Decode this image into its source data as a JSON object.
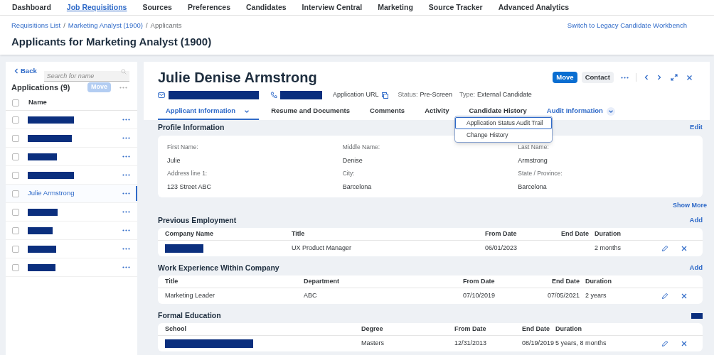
{
  "top_nav": [
    {
      "label": "Dashboard",
      "selected": false
    },
    {
      "label": "Job Requisitions",
      "selected": true
    },
    {
      "label": "Sources",
      "selected": false
    },
    {
      "label": "Preferences",
      "selected": false
    },
    {
      "label": "Candidates",
      "selected": false
    },
    {
      "label": "Interview Central",
      "selected": false
    },
    {
      "label": "Marketing",
      "selected": false
    },
    {
      "label": "Source Tracker",
      "selected": false
    },
    {
      "label": "Advanced Analytics",
      "selected": false
    }
  ],
  "breadcrumbs": [
    "Requisitions List",
    "Marketing Analyst (1900)",
    "Applicants"
  ],
  "breadcrumb_separator": "/",
  "legacy_link": "Switch to Legacy Candidate Workbench",
  "page_title": "Applicants for Marketing Analyst (1900)",
  "sidebar": {
    "back": "Back",
    "search": {
      "placeholder": "Search for name"
    },
    "title": "Applications (9)",
    "all_checked": false,
    "move_button": {
      "label": "Move",
      "disabled": true
    },
    "column": "Name",
    "items": [
      {
        "kind": "redacted",
        "selected": false,
        "checked": false
      },
      {
        "kind": "redacted",
        "selected": false,
        "checked": false
      },
      {
        "kind": "redacted",
        "selected": false,
        "checked": false
      },
      {
        "kind": "redacted",
        "selected": false,
        "checked": false
      },
      {
        "kind": "name",
        "name": "Julie Armstrong",
        "selected": true,
        "checked": false
      },
      {
        "kind": "redacted",
        "selected": false,
        "checked": false
      },
      {
        "kind": "redacted",
        "selected": false,
        "checked": false
      },
      {
        "kind": "redacted",
        "selected": false,
        "checked": false
      },
      {
        "kind": "redacted",
        "selected": false,
        "checked": false
      }
    ]
  },
  "candidate": {
    "name": "Julie Denise Armstrong",
    "application_url": "Application URL",
    "status_label": "Status:",
    "status": "Pre-Screen",
    "type_label": "Type:",
    "type": "External Candidate",
    "actions": [
      {
        "label": "Move",
        "kind": "primary"
      },
      {
        "label": "Contact",
        "kind": "secondary"
      }
    ]
  },
  "tabs": [
    {
      "label": "Applicant Information",
      "selected": true,
      "menu": true
    },
    {
      "label": "Resume and Documents",
      "selected": false,
      "menu": false
    },
    {
      "label": "Comments",
      "selected": false,
      "menu": false
    },
    {
      "label": "Activity",
      "selected": false,
      "menu": false
    },
    {
      "label": "Candidate History",
      "selected": false,
      "menu": false
    },
    {
      "label": "Audit Information",
      "selected": false,
      "menu": true,
      "link": true
    }
  ],
  "tab_menu": [
    {
      "label": "Application Status Audit Trail",
      "selected": true
    },
    {
      "label": "Change History",
      "selected": false
    }
  ],
  "profile": {
    "title": "Profile Information",
    "action": "Edit",
    "fields": [
      {
        "label": "First Name:",
        "value": "Julie"
      },
      {
        "label": "Middle Name:",
        "value": "Denise"
      },
      {
        "label": "Last Name:",
        "value": "Armstrong"
      },
      {
        "label": "Address line 1:",
        "value": "123 Street ABC"
      },
      {
        "label": "City:",
        "value": "Barcelona"
      },
      {
        "label": "State / Province:",
        "value": "Barcelona"
      }
    ],
    "show_more": "Show More"
  },
  "sections": [
    {
      "title": "Previous Employment",
      "action": {
        "kind": "link",
        "label": "Add"
      },
      "columns": [
        "Company Name",
        "Title",
        "From Date",
        "End Date",
        "Duration"
      ],
      "rows": [
        [
          {
            "kind": "redacted"
          },
          "UX Product Manager",
          "06/01/2023",
          "",
          "2 months"
        ]
      ]
    },
    {
      "title": "Work Experience Within Company",
      "action": {
        "kind": "link",
        "label": "Add"
      },
      "columns": [
        "Title",
        "Department",
        "From Date",
        "End Date",
        "Duration"
      ],
      "rows": [
        [
          "Marketing Leader",
          "ABC",
          "07/10/2019",
          "07/05/2021",
          "2 years"
        ]
      ]
    },
    {
      "title": "Formal Education",
      "action": {
        "kind": "redacted"
      },
      "columns": [
        "School",
        "Degree",
        "From Date",
        "End Date",
        "Duration"
      ],
      "rows": [
        [
          {
            "kind": "redacted"
          },
          "Masters",
          "12/31/2013",
          "08/19/2019",
          "5 years, 8 months"
        ]
      ]
    }
  ]
}
